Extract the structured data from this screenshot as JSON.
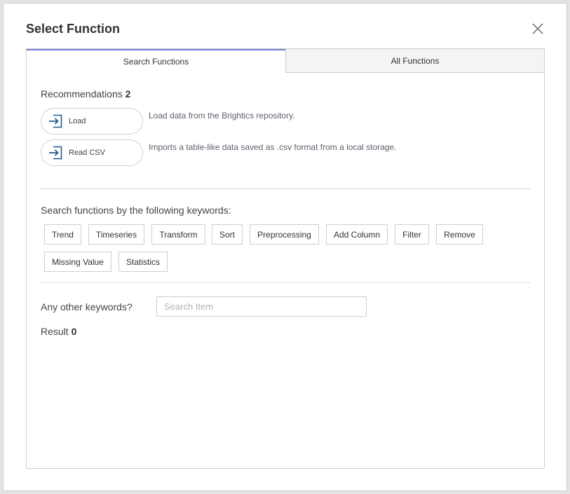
{
  "dialog": {
    "title": "Select Function"
  },
  "tabs": [
    {
      "label": "Search Functions",
      "active": true
    },
    {
      "label": "All Functions",
      "active": false
    }
  ],
  "recommendations": {
    "label": "Recommendations",
    "count": "2",
    "items": [
      {
        "label": "Load",
        "description": "Load data from the Brightics repository.",
        "icon": "arrow-into-box-icon"
      },
      {
        "label": "Read CSV",
        "description": "Imports a table-like data saved as .csv format from a local storage.",
        "icon": "arrow-into-box-icon"
      }
    ]
  },
  "keywords": {
    "title": "Search functions by the following keywords:",
    "items": [
      "Trend",
      "Timeseries",
      "Transform",
      "Sort",
      "Preprocessing",
      "Add Column",
      "Filter",
      "Remove",
      "Missing Value",
      "Statistics"
    ]
  },
  "search": {
    "label": "Any other keywords?",
    "placeholder": "Search Item",
    "value": ""
  },
  "result": {
    "label": "Result",
    "count": "0"
  },
  "colors": {
    "active_tab_border": "#7082d6",
    "icon_blue": "#1e5b8f"
  }
}
